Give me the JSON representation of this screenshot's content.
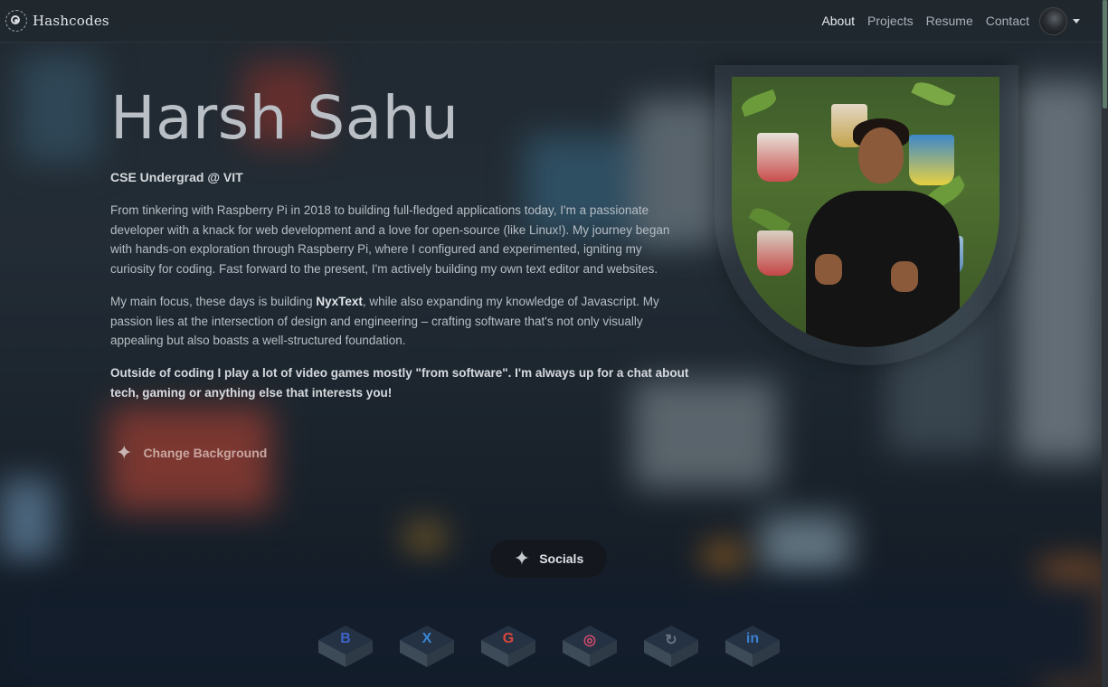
{
  "nav": {
    "brand": "Hashcodes",
    "links": [
      "About",
      "Projects",
      "Resume",
      "Contact"
    ],
    "active": "About"
  },
  "hero": {
    "name": "Harsh Sahu",
    "tagline": "CSE Undergrad @ VIT",
    "para1": "From tinkering with Raspberry Pi in 2018 to building full-fledged applications today, I'm a passionate developer with a knack for web development and a love for open-source (like Linux!). My journey began with hands-on exploration through Raspberry Pi, where I configured and experimented, igniting my curiosity for coding. Fast forward to the present, I'm actively building my own text editor and websites.",
    "para2_before": "My main focus, these days is building ",
    "para2_bold": "NyxText",
    "para2_after": ", while also expanding my knowledge of Javascript. My passion lies at the intersection of design and engineering – crafting software that's not only visually appealing but also boasts a well-structured foundation.",
    "para3": "Outside of coding I play a lot of video games mostly \"from software\". I'm always up for a chat about tech, gaming or anything else that interests you!",
    "change_bg_label": "Change Background"
  },
  "socials": {
    "button_label": "Socials",
    "icons": [
      {
        "name": "behance-icon",
        "glyph": "B",
        "color": "#3e63c8"
      },
      {
        "name": "x-icon",
        "glyph": "X",
        "color": "#3a86d6"
      },
      {
        "name": "google-icon",
        "glyph": "G",
        "color": "#d8453b"
      },
      {
        "name": "instagram-icon",
        "glyph": "◎",
        "color": "#d04a6a"
      },
      {
        "name": "sync-icon",
        "glyph": "↻",
        "color": "#6b7480"
      },
      {
        "name": "linkedin-icon",
        "glyph": "in",
        "color": "#3a7fd0"
      }
    ]
  },
  "colors": {
    "navbar": "#21282f",
    "accent": "#5d7a6a"
  }
}
